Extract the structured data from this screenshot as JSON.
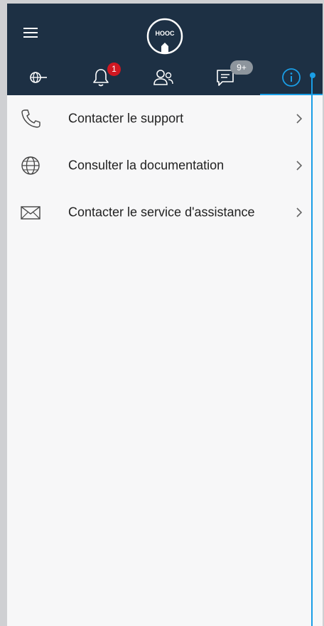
{
  "header": {
    "logo_text": "HOOC",
    "background_color": "#1d3044"
  },
  "tabs": [
    {
      "icon": "globe-network-icon"
    },
    {
      "icon": "bell-icon",
      "badge": "1"
    },
    {
      "icon": "users-icon"
    },
    {
      "icon": "chat-icon",
      "badge": "9+"
    },
    {
      "icon": "info-icon",
      "active": true
    }
  ],
  "accent_color": "#1a9ee6",
  "list": {
    "items": [
      {
        "label": "Contacter le support",
        "icon": "phone-icon"
      },
      {
        "label": "Consulter la documentation",
        "icon": "globe-icon"
      },
      {
        "label": "Contacter le service d'assistance",
        "icon": "envelope-icon"
      }
    ]
  }
}
